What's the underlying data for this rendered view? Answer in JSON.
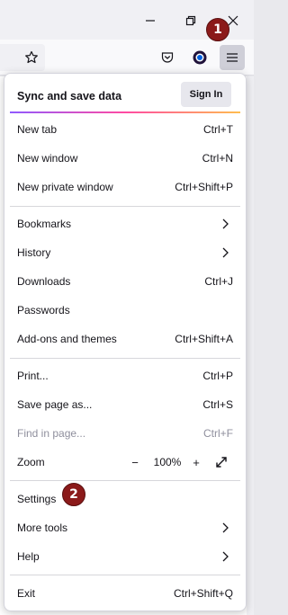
{
  "badges": {
    "first": "1",
    "second": "2"
  },
  "sync": {
    "label": "Sync and save data",
    "signin_label": "Sign In"
  },
  "menu": {
    "new_tab": {
      "label": "New tab",
      "shortcut": "Ctrl+T"
    },
    "new_window": {
      "label": "New window",
      "shortcut": "Ctrl+N"
    },
    "new_private_window": {
      "label": "New private window",
      "shortcut": "Ctrl+Shift+P"
    },
    "bookmarks": {
      "label": "Bookmarks"
    },
    "history": {
      "label": "History"
    },
    "downloads": {
      "label": "Downloads",
      "shortcut": "Ctrl+J"
    },
    "passwords": {
      "label": "Passwords"
    },
    "addons": {
      "label": "Add-ons and themes",
      "shortcut": "Ctrl+Shift+A"
    },
    "print": {
      "label": "Print...",
      "shortcut": "Ctrl+P"
    },
    "save_page": {
      "label": "Save page as...",
      "shortcut": "Ctrl+S"
    },
    "find": {
      "label": "Find in page...",
      "shortcut": "Ctrl+F"
    },
    "zoom": {
      "label": "Zoom",
      "minus": "−",
      "value": "100%",
      "plus": "+"
    },
    "settings": {
      "label": "Settings"
    },
    "more_tools": {
      "label": "More tools"
    },
    "help": {
      "label": "Help"
    },
    "exit": {
      "label": "Exit",
      "shortcut": "Ctrl+Shift+Q"
    }
  },
  "icons": {
    "minimize": "minimize-icon",
    "restore": "restore-icon",
    "close": "close-icon",
    "bookmark_star": "star-icon",
    "pocket": "pocket-icon",
    "account": "account-icon",
    "menu": "hamburger-menu-icon",
    "fullscreen": "fullscreen-icon",
    "chevron": "chevron-right-icon"
  },
  "colors": {
    "badge": "#8b1a1a",
    "gradient_start": "#9059ff",
    "gradient_mid": "#ff4aa2",
    "gradient_end": "#ffbd4f"
  }
}
